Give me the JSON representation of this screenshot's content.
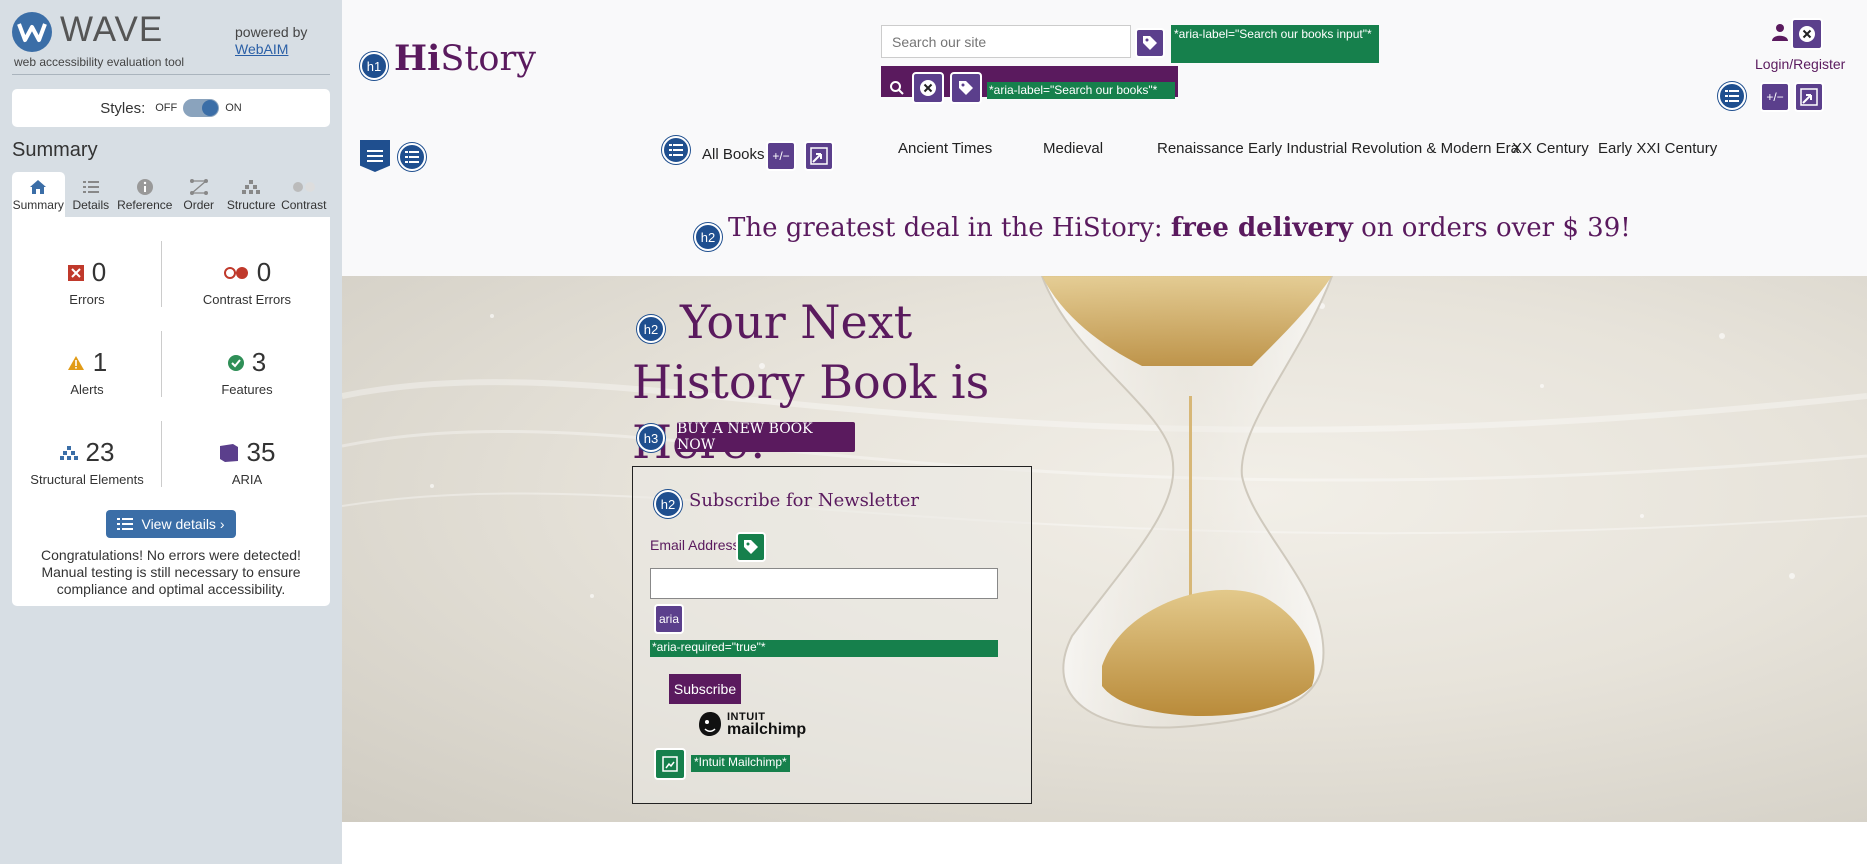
{
  "wave": {
    "title": "WAVE",
    "subtitle": "web accessibility evaluation tool",
    "powered_by": "powered by",
    "webaim_link": "WebAIM",
    "styles_label": "Styles:",
    "styles_off": "OFF",
    "styles_on": "ON",
    "summary_heading": "Summary",
    "tabs": [
      {
        "label": "Summary",
        "icon": "home-icon",
        "active": true
      },
      {
        "label": "Details",
        "icon": "list-icon"
      },
      {
        "label": "Reference",
        "icon": "info-icon"
      },
      {
        "label": "Order",
        "icon": "order-icon"
      },
      {
        "label": "Structure",
        "icon": "structure-icon"
      },
      {
        "label": "Contrast",
        "icon": "contrast-icon"
      }
    ],
    "stats": {
      "errors": {
        "value": "0",
        "label": "Errors",
        "color": "#c0392b"
      },
      "contrast": {
        "value": "0",
        "label": "Contrast Errors",
        "color": "#c0392b"
      },
      "alerts": {
        "value": "1",
        "label": "Alerts",
        "color": "#e19b17"
      },
      "features": {
        "value": "3",
        "label": "Features",
        "color": "#2f8f57"
      },
      "structural": {
        "value": "23",
        "label": "Structural Elements",
        "color": "#3b6ea7"
      },
      "aria": {
        "value": "35",
        "label": "ARIA",
        "color": "#5b3f8c"
      }
    },
    "view_details": "View details ›",
    "congrats": "Congratulations! No errors were detected! Manual testing is still necessary to ensure compliance and optimal accessibility."
  },
  "site": {
    "logo_bold": "Hi",
    "logo_rest": "Story",
    "search_placeholder": "Search our site",
    "aria_label_search_input": "*aria-label=\"Search our books input\"*",
    "aria_label_search_books": "*aria-label=\"Search our books\"*",
    "login": "Login/Register",
    "nav": {
      "all_books": "All Books",
      "items": [
        "Ancient Times",
        "Medieval",
        "Renaissance",
        "Early Industrial Revolution & Modern Era",
        "XX Century",
        "Early XXI Century"
      ]
    },
    "promo_pre": "The greatest deal in the HiStory: ",
    "promo_bold": "free delivery",
    "promo_post": " on orders over $ 39!",
    "hero_title": "Your Next History Book is Here!",
    "buy_button": "BUY A NEW BOOK NOW",
    "newsletter_title": "Subscribe for Newsletter",
    "email_label": "Email Address",
    "aria_badge": "aria",
    "aria_required": "*aria-required=\"true\"*",
    "subscribe_button": "Subscribe",
    "mailchimp_top": "INTUIT",
    "mailchimp_bottom": "mailchimp",
    "mailchimp_alt": "*Intuit Mailchimp*",
    "heading_tags": {
      "h1": "h1",
      "h2": "h2",
      "h3": "h3"
    }
  },
  "colors": {
    "brand_purple": "#5a1a5e",
    "wave_blue": "#3b6ea7",
    "feature_green": "#16804c"
  }
}
